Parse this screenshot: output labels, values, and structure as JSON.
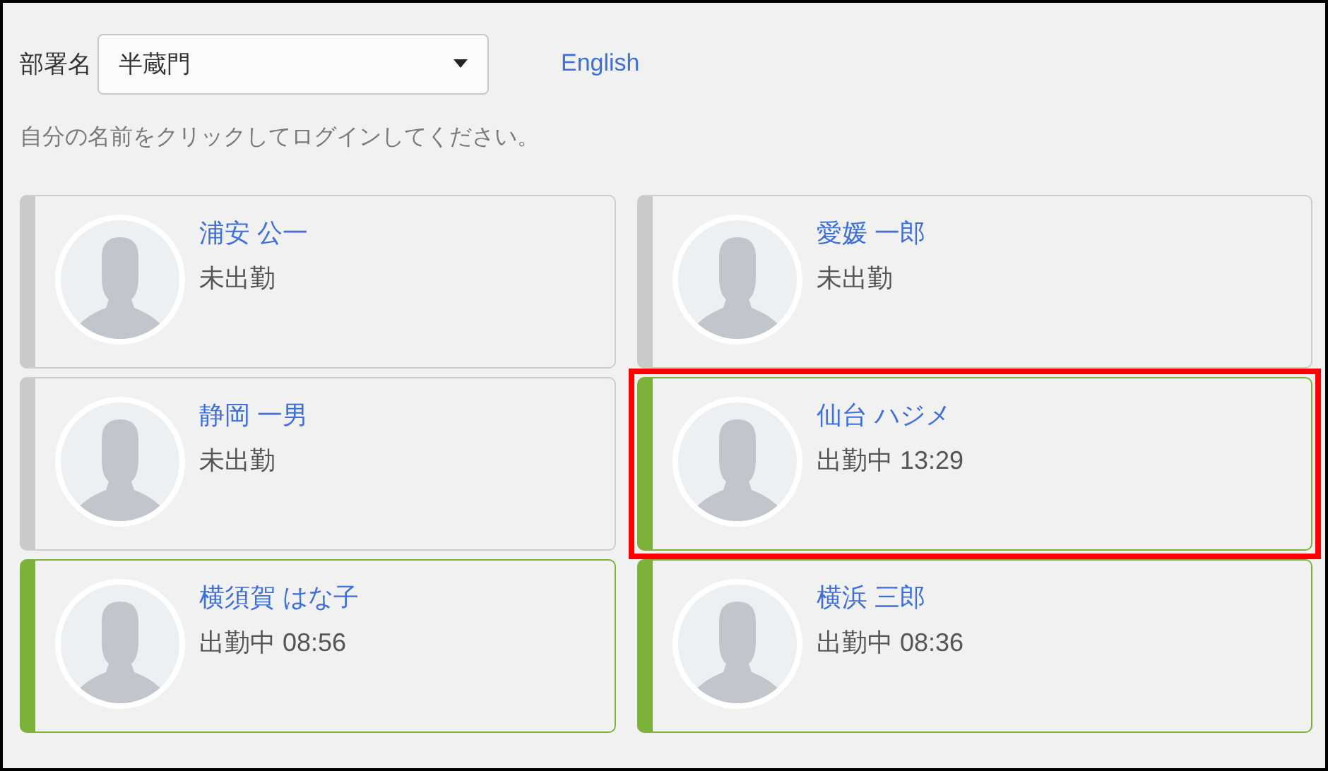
{
  "department": {
    "label": "部署名",
    "value": "半蔵門"
  },
  "language_link": "English",
  "instruction": "自分の名前をクリックしてログインしてください。",
  "employees": [
    {
      "name": "浦安 公一",
      "status": "未出勤",
      "on_duty": false,
      "highlighted": false
    },
    {
      "name": "愛媛 一郎",
      "status": "未出勤",
      "on_duty": false,
      "highlighted": false
    },
    {
      "name": "静岡 一男",
      "status": "未出勤",
      "on_duty": false,
      "highlighted": false
    },
    {
      "name": "仙台 ハジメ",
      "status": "出勤中 13:29",
      "on_duty": true,
      "highlighted": true
    },
    {
      "name": "横須賀 はな子",
      "status": "出勤中 08:56",
      "on_duty": true,
      "highlighted": false
    },
    {
      "name": "横浜 三郎",
      "status": "出勤中 08:36",
      "on_duty": true,
      "highlighted": false
    }
  ]
}
